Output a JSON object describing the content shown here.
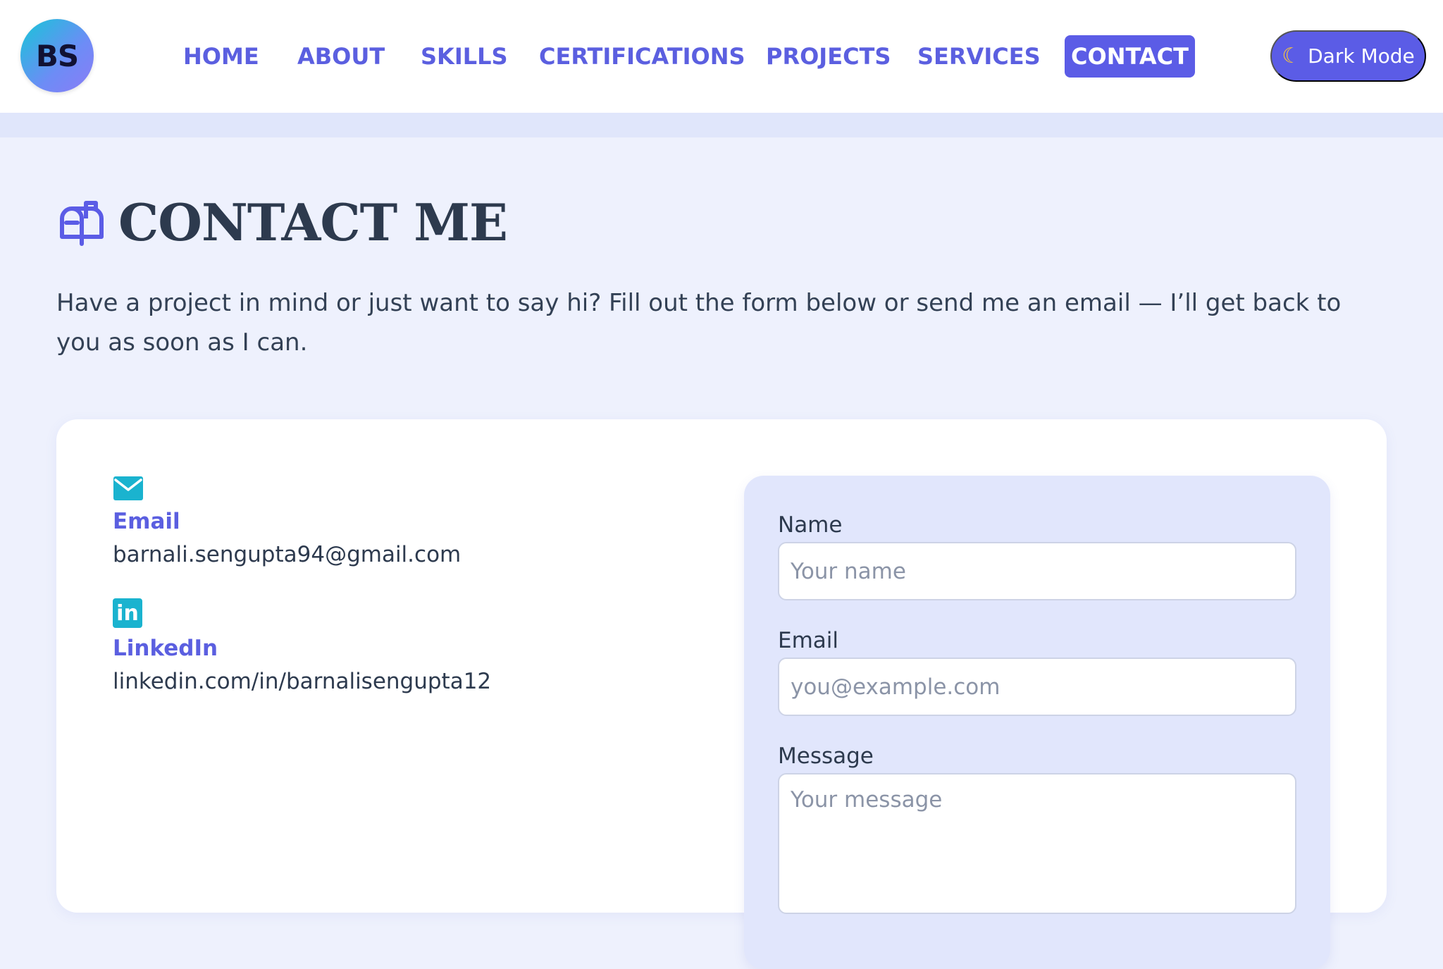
{
  "brand": {
    "logo_text": "BS"
  },
  "nav": {
    "links": [
      {
        "label": "HOME"
      },
      {
        "label": "ABOUT"
      },
      {
        "label": "SKILLS"
      },
      {
        "label": "CERTIFICATIONS"
      },
      {
        "label": "PROJECTS"
      },
      {
        "label": "SERVICES"
      },
      {
        "label": "CONTACT",
        "active": true
      }
    ],
    "dark_mode_label": "Dark Mode",
    "dark_mode_icon": "moon-icon"
  },
  "section": {
    "icon": "mailbox-icon",
    "title": "CONTACT ME",
    "intro": "Have a project in mind or just want to say hi? Fill out the form below or send me an email — I’ll get back to you as soon as I can."
  },
  "contact_info": {
    "email": {
      "icon": "envelope-icon",
      "label": "Email",
      "value": "barnali.sengupta94@gmail.com"
    },
    "linkedin": {
      "icon": "linkedin-icon",
      "icon_text": "in",
      "label": "LinkedIn",
      "value": "linkedin.com/in/barnalisengupta12"
    }
  },
  "form": {
    "name": {
      "label": "Name",
      "placeholder": "Your name",
      "value": ""
    },
    "email": {
      "label": "Email",
      "placeholder": "you@example.com",
      "value": ""
    },
    "message": {
      "label": "Message",
      "placeholder": "Your message",
      "value": ""
    }
  },
  "colors": {
    "accent": "#5b5ce6",
    "nav_text": "#5b5fe0",
    "page_bg": "#eef1fd",
    "form_bg": "#e1e6fc",
    "icon_teal": "#1ab3cf",
    "heading": "#2d3a4e"
  }
}
